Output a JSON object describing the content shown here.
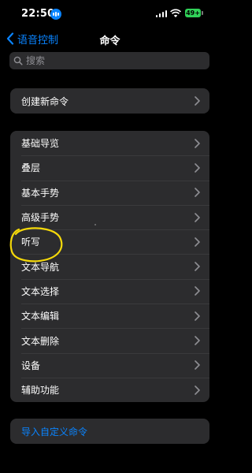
{
  "status": {
    "time": "22:50",
    "battery": "49+"
  },
  "nav": {
    "back_label": "语音控制",
    "title": "命令"
  },
  "search": {
    "placeholder": "搜索"
  },
  "create_group": {
    "items": [
      {
        "label": "创建新命令"
      }
    ]
  },
  "commands": {
    "items": [
      {
        "label": "基础导览"
      },
      {
        "label": "叠层"
      },
      {
        "label": "基本手势"
      },
      {
        "label": "高级手势"
      },
      {
        "label": "听写"
      },
      {
        "label": "文本导航"
      },
      {
        "label": "文本选择"
      },
      {
        "label": "文本编辑"
      },
      {
        "label": "文本删除"
      },
      {
        "label": "设备"
      },
      {
        "label": "辅助功能"
      }
    ]
  },
  "import_group": {
    "items": [
      {
        "label": "导入自定义命令"
      }
    ]
  },
  "colors": {
    "accent": "#0a84ff",
    "background": "#000000",
    "cell": "#2c2c2e",
    "annotation": "#f5d90a"
  }
}
